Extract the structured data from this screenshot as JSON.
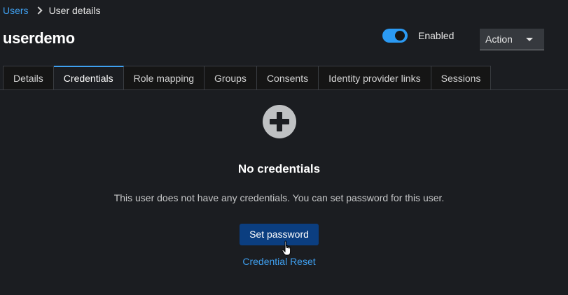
{
  "breadcrumb": {
    "parent": "Users",
    "current": "User details"
  },
  "header": {
    "title": "userdemo",
    "enabled_label": "Enabled",
    "enabled": true,
    "action_label": "Action"
  },
  "tabs": [
    {
      "label": "Details",
      "active": false
    },
    {
      "label": "Credentials",
      "active": true
    },
    {
      "label": "Role mapping",
      "active": false
    },
    {
      "label": "Groups",
      "active": false
    },
    {
      "label": "Consents",
      "active": false
    },
    {
      "label": "Identity provider links",
      "active": false
    },
    {
      "label": "Sessions",
      "active": false
    }
  ],
  "empty_state": {
    "icon": "plus-circle-icon",
    "title": "No credentials",
    "body": "This user does not have any credentials. You can set password for this user.",
    "primary_button": "Set password",
    "link_button": "Credential Reset"
  },
  "colors": {
    "background": "#1b1d21",
    "accent": "#2b9af3",
    "link": "#3fa0f0",
    "primary_button": "#0b3e80"
  }
}
